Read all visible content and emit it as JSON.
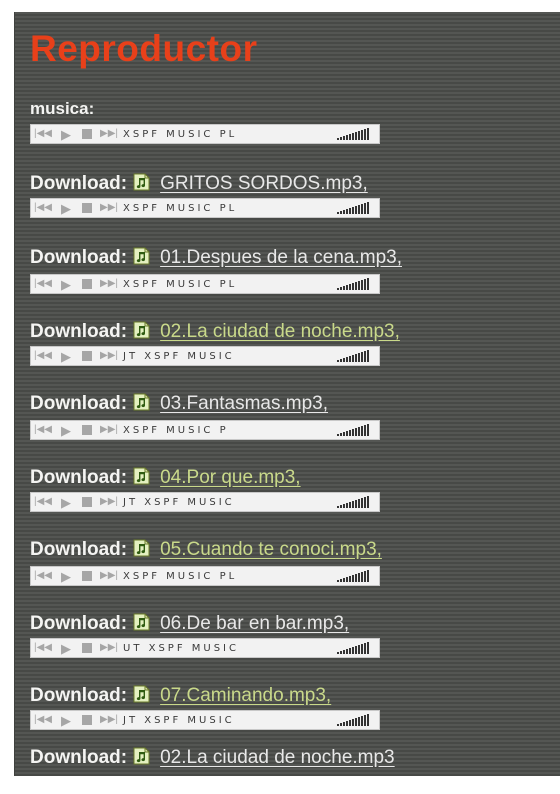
{
  "page": {
    "title": "Reproductor",
    "music_label": "musica:"
  },
  "colors": {
    "title": "#e8401a",
    "link_white": "#e8e8e8",
    "link_green": "#c9d98a",
    "panel_bg": "#4d4f4c"
  },
  "player": {
    "buttons": [
      "prev-icon",
      "play-icon",
      "stop-icon",
      "next-icon"
    ],
    "volume_icon": "volume-bars-icon"
  },
  "players": [
    {
      "title": "XSPF MUSIC PL"
    },
    {
      "title": "XSPF MUSIC PL"
    },
    {
      "title": "XSPF MUSIC PL"
    },
    {
      "title": "JT XSPF MUSIC"
    },
    {
      "title": " XSPF MUSIC P"
    },
    {
      "title": "JT XSPF MUSIC"
    },
    {
      "title": "XSPF MUSIC PL"
    },
    {
      "title": "UT XSPF MUSIC"
    },
    {
      "title": "JT XSPF MUSIC"
    }
  ],
  "downloads": [
    {
      "label": "Download:",
      "icon": "music-file-icon",
      "file": "GRITOS SORDOS.mp3,",
      "link_color": "white"
    },
    {
      "label": "Download:",
      "icon": "music-file-icon",
      "file": "01.Despues de la cena.mp3,",
      "link_color": "white"
    },
    {
      "label": "Download:",
      "icon": "music-file-icon",
      "file": "02.La ciudad de noche.mp3,",
      "link_color": "green"
    },
    {
      "label": "Download:",
      "icon": "music-file-icon",
      "file": "03.Fantasmas.mp3,",
      "link_color": "white"
    },
    {
      "label": "Download:",
      "icon": "music-file-icon",
      "file": "04.Por que.mp3,",
      "link_color": "green"
    },
    {
      "label": "Download:",
      "icon": "music-file-icon",
      "file": "05.Cuando te conoci.mp3,",
      "link_color": "green"
    },
    {
      "label": "Download:",
      "icon": "music-file-icon",
      "file": "06.De bar en bar.mp3,",
      "link_color": "white"
    },
    {
      "label": "Download:",
      "icon": "music-file-icon",
      "file": "07.Caminando.mp3,",
      "link_color": "green"
    },
    {
      "label": "Download:",
      "icon": "music-file-icon",
      "file": "02.La ciudad de noche.mp3",
      "link_color": "white"
    }
  ]
}
